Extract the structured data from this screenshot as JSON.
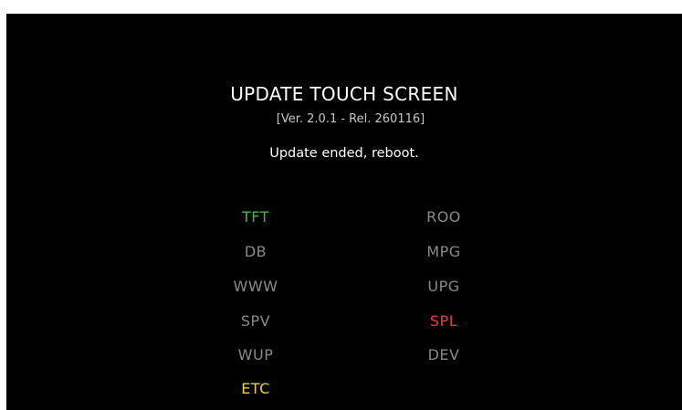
{
  "title": "UPDATE TOUCH SCREEN",
  "version": "[Ver. 2.0.1 - Rel. 260116]",
  "status": "Update ended, reboot.",
  "colors": {
    "background": "#000000",
    "default_module": "#8a8a8a",
    "ok": "#4caf50",
    "error": "#f03c3c",
    "pending": "#f0d040"
  },
  "modules": {
    "tft": {
      "label": "TFT",
      "color": "#4caf50"
    },
    "db": {
      "label": "DB",
      "color": "#8a8a8a"
    },
    "www": {
      "label": "WWW",
      "color": "#8a8a8a"
    },
    "spv": {
      "label": "SPV",
      "color": "#8a8a8a"
    },
    "wup": {
      "label": "WUP",
      "color": "#8a8a8a"
    },
    "etc": {
      "label": "ETC",
      "color": "#f0d040"
    },
    "roo": {
      "label": "ROO",
      "color": "#8a8a8a"
    },
    "mpg": {
      "label": "MPG",
      "color": "#8a8a8a"
    },
    "upg": {
      "label": "UPG",
      "color": "#8a8a8a"
    },
    "spl": {
      "label": "SPL",
      "color": "#f03c3c"
    },
    "dev": {
      "label": "DEV",
      "color": "#8a8a8a"
    }
  }
}
